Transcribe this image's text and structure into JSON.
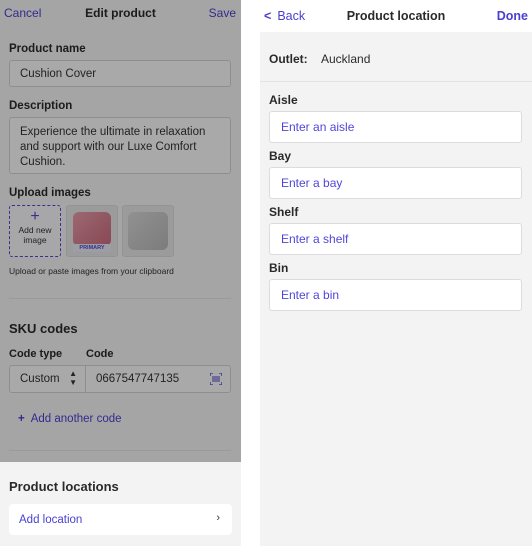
{
  "edit_product": {
    "header": {
      "cancel": "Cancel",
      "title": "Edit product",
      "save": "Save"
    },
    "product_name": {
      "label": "Product name",
      "value": "Cushion Cover"
    },
    "description": {
      "label": "Description",
      "value": "Experience the ultimate in relaxation and support with our Luxe Comfort Cushion."
    },
    "upload": {
      "label": "Upload images",
      "add_label_line1": "Add new",
      "add_label_line2": "image",
      "primary_badge": "PRIMARY",
      "helper": "Upload or paste images from your clipboard"
    },
    "sku": {
      "title": "SKU codes",
      "code_type_label": "Code type",
      "code_label": "Code",
      "code_type_value": "Custom",
      "code_value": "0667547747135",
      "add_code": "Add another code"
    },
    "locations": {
      "title": "Product locations",
      "add_location": "Add location"
    }
  },
  "product_location": {
    "header": {
      "back": "Back",
      "title": "Product location",
      "done": "Done"
    },
    "outlet": {
      "label": "Outlet:",
      "value": "Auckland"
    },
    "fields": [
      {
        "label": "Aisle",
        "placeholder": "Enter an aisle"
      },
      {
        "label": "Bay",
        "placeholder": "Enter a bay"
      },
      {
        "label": "Shelf",
        "placeholder": "Enter a shelf"
      },
      {
        "label": "Bin",
        "placeholder": "Enter a bin"
      }
    ]
  },
  "colors": {
    "accent": "#4a3fd1",
    "overlay": "rgba(0,0,0,0.32)"
  }
}
